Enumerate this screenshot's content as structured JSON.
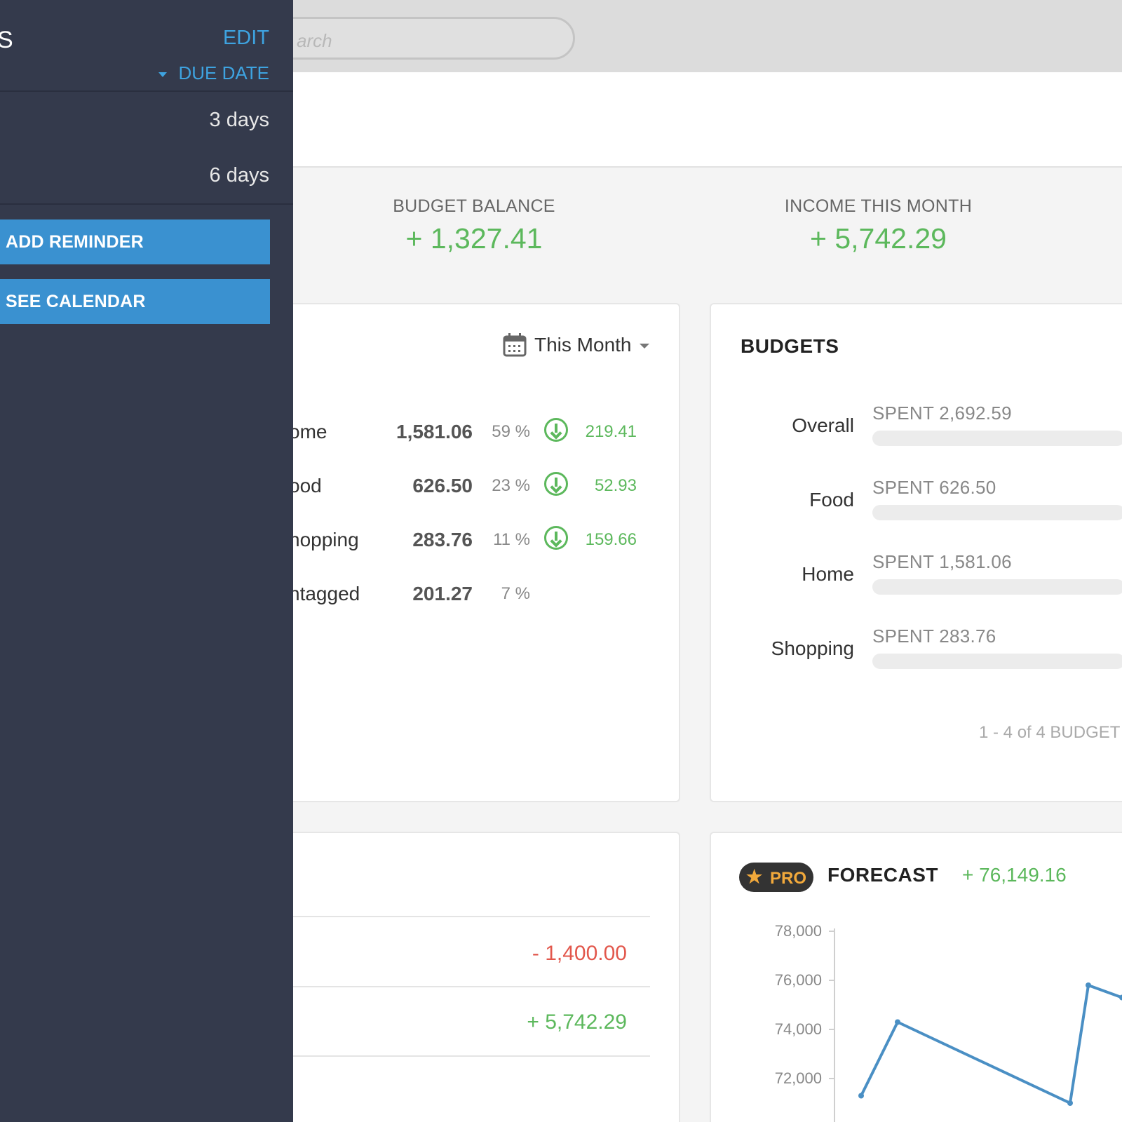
{
  "search": {
    "placeholder": "Search",
    "visible_text": "arch"
  },
  "stats": {
    "budget_balance_label": "BUDGET BALANCE",
    "budget_balance_value": "+ 1,327.41",
    "income_label": "INCOME THIS MONTH",
    "income_value": "+ 5,742.29"
  },
  "spending": {
    "period": "This Month",
    "rows": [
      {
        "name": "ome",
        "amount": "1,581.06",
        "pct": "59 %",
        "delta": "219.41",
        "has_icon": true
      },
      {
        "name": "ood",
        "amount": "626.50",
        "pct": "23 %",
        "delta": "52.93",
        "has_icon": true
      },
      {
        "name": "hopping",
        "amount": "283.76",
        "pct": "11 %",
        "delta": "159.66",
        "has_icon": true
      },
      {
        "name": "ntagged",
        "amount": "201.27",
        "pct": "7 %",
        "delta": "",
        "has_icon": false
      }
    ]
  },
  "budgets": {
    "title": "BUDGETS",
    "items": [
      {
        "label": "Overall",
        "spent": "SPENT 2,692.59",
        "fill_fraction": 0.0
      },
      {
        "label": "Food",
        "spent": "SPENT 626.50",
        "fill_fraction": 0.0
      },
      {
        "label": "Home",
        "spent": "SPENT 1,581.06",
        "fill_fraction": 0.0
      },
      {
        "label": "Shopping",
        "spent": "SPENT 283.76",
        "fill_fraction": 0.0
      }
    ],
    "pagination": "1 - 4 of 4 BUDGET"
  },
  "cashflow": {
    "rows": [
      {
        "value": "- 1,400.00",
        "sign": "negative"
      },
      {
        "value": "+ 5,742.29",
        "sign": "positive"
      }
    ]
  },
  "forecast": {
    "badge": "PRO",
    "title": "FORECAST",
    "total": "+ 76,149.16",
    "chart_data": {
      "type": "line",
      "yticks": [
        "78,000",
        "76,000",
        "74,000",
        "72,000"
      ],
      "ylim": [
        71000,
        79000
      ],
      "series": [
        {
          "values": [
            71300,
            74300,
            71000,
            75800,
            75300
          ]
        }
      ]
    }
  },
  "side_panel": {
    "title": "S",
    "edit_label": "EDIT",
    "sort_label": "DUE DATE",
    "reminders": [
      {
        "days": "3 days"
      },
      {
        "days": "6 days"
      }
    ],
    "add_reminder_label": "ADD REMINDER",
    "see_calendar_label": "SEE CALENDAR"
  },
  "colors": {
    "accent": "#3ea3e0",
    "positive": "#5cb85c",
    "negative": "#e2574c",
    "panel": "#343a4c",
    "pro": "#f2a93b"
  }
}
